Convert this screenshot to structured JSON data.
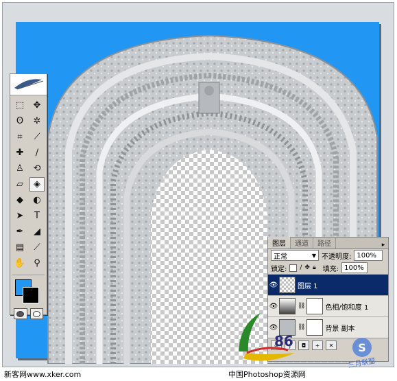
{
  "toolbox": {
    "tools": [
      {
        "icon": "marquee-icon",
        "glyph": "⬚"
      },
      {
        "icon": "move-icon",
        "glyph": "✥"
      },
      {
        "icon": "lasso-icon",
        "glyph": "ʘ"
      },
      {
        "icon": "magic-wand-icon",
        "glyph": "✲"
      },
      {
        "icon": "crop-icon",
        "glyph": "⌗"
      },
      {
        "icon": "slice-icon",
        "glyph": "⟋"
      },
      {
        "icon": "healing-brush-icon",
        "glyph": "✚"
      },
      {
        "icon": "brush-icon",
        "glyph": "∕"
      },
      {
        "icon": "clone-stamp-icon",
        "glyph": "♙"
      },
      {
        "icon": "history-brush-icon",
        "glyph": "⟲"
      },
      {
        "icon": "eraser-icon",
        "glyph": "▱"
      },
      {
        "icon": "paint-bucket-icon",
        "glyph": "◈"
      },
      {
        "icon": "blur-icon",
        "glyph": "◆"
      },
      {
        "icon": "dodge-icon",
        "glyph": "◐"
      },
      {
        "icon": "path-selection-icon",
        "glyph": "➤"
      },
      {
        "icon": "type-icon",
        "glyph": "T"
      },
      {
        "icon": "pen-icon",
        "glyph": "✒"
      },
      {
        "icon": "shape-icon",
        "glyph": "◢"
      },
      {
        "icon": "notes-icon",
        "glyph": "▤"
      },
      {
        "icon": "eyedropper-icon",
        "glyph": "⟋"
      },
      {
        "icon": "hand-icon",
        "glyph": "✋"
      },
      {
        "icon": "zoom-icon",
        "glyph": "⚲"
      }
    ],
    "foreground_color": "#2196f3",
    "background_color": "#000000"
  },
  "layers_panel": {
    "tabs": [
      "图层",
      "通道",
      "路径"
    ],
    "blend_mode": "正常",
    "opacity_label": "不透明度:",
    "opacity_value": "100%",
    "lock_label": "锁定:",
    "fill_label": "填充:",
    "fill_value": "100%",
    "layers": [
      {
        "name": "图层 1",
        "selected": true
      },
      {
        "name": "色相/饱和度 1",
        "selected": false
      },
      {
        "name": "背景 副本",
        "selected": false
      }
    ]
  },
  "captions": {
    "left": "新客网www.xker.com",
    "center": "中国Photoshop资源网",
    "logo_number": "86",
    "watermark": "三月联盟"
  }
}
